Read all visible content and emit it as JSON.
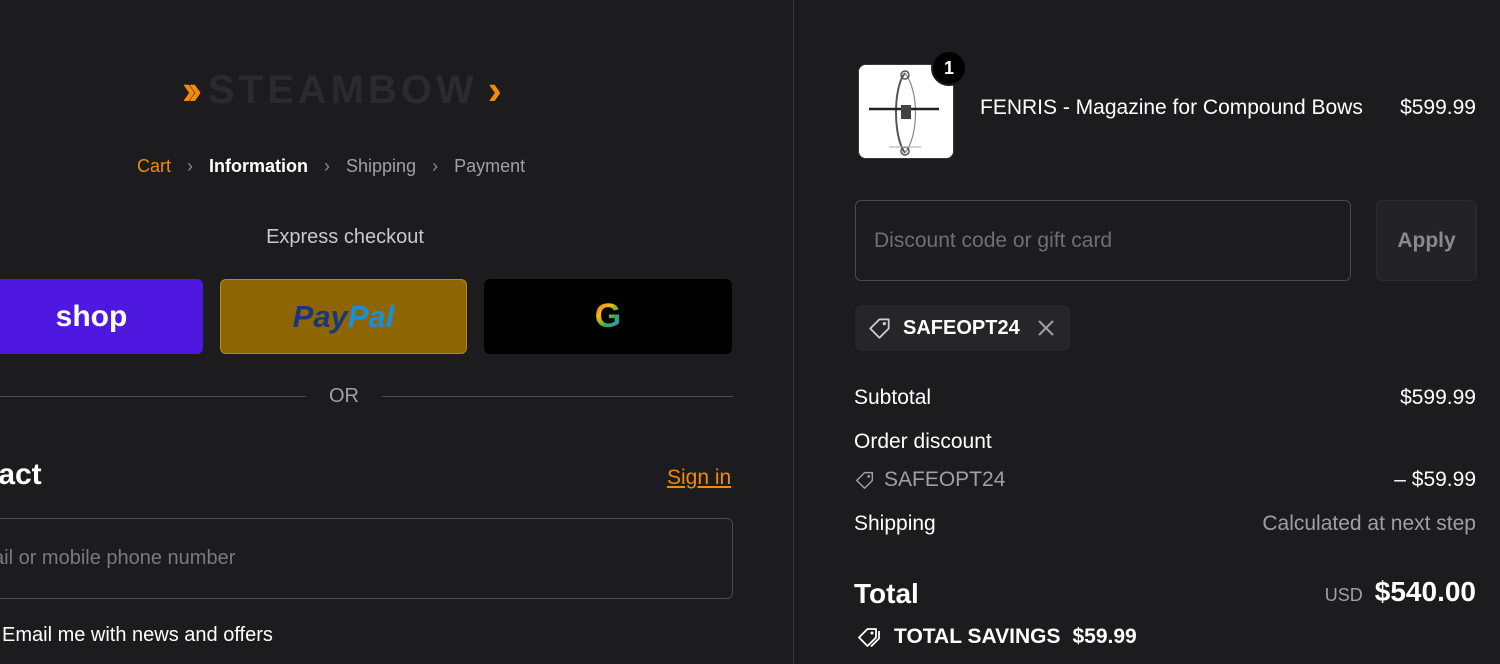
{
  "brand": {
    "name": "STEAMBOW"
  },
  "breadcrumb": {
    "cart": "Cart",
    "information": "Information",
    "shipping": "Shipping",
    "payment": "Payment"
  },
  "express": {
    "label": "Express checkout",
    "shop_label": "shop",
    "paypal_part1": "Pay",
    "paypal_part2": "Pal",
    "google_label": "G",
    "or_text": "OR"
  },
  "contact": {
    "title": "ntact",
    "sign_in": "Sign in",
    "email_placeholder": "ail or mobile phone number",
    "news_label": "Email me with news and offers"
  },
  "order": {
    "item": {
      "name": "FENRIS - Magazine for Compound Bows",
      "price": "$599.99",
      "quantity": "1"
    },
    "discount_placeholder": "Discount code or gift card",
    "apply_label": "Apply",
    "applied_code": "SAFEOPT24",
    "subtotal_label": "Subtotal",
    "subtotal_value": "$599.99",
    "order_discount_label": "Order discount",
    "discount_code": "SAFEOPT24",
    "discount_value": "– $59.99",
    "shipping_label": "Shipping",
    "shipping_value": "Calculated at next step",
    "total_label": "Total",
    "currency": "USD",
    "total_value": "$540.00",
    "savings_label": "TOTAL SAVINGS",
    "savings_value": "$59.99"
  },
  "colors": {
    "accent": "#f28a0c",
    "background": "#1c1c1e",
    "shop_purple": "#4f18e0",
    "paypal_gold": "#8d6603"
  }
}
